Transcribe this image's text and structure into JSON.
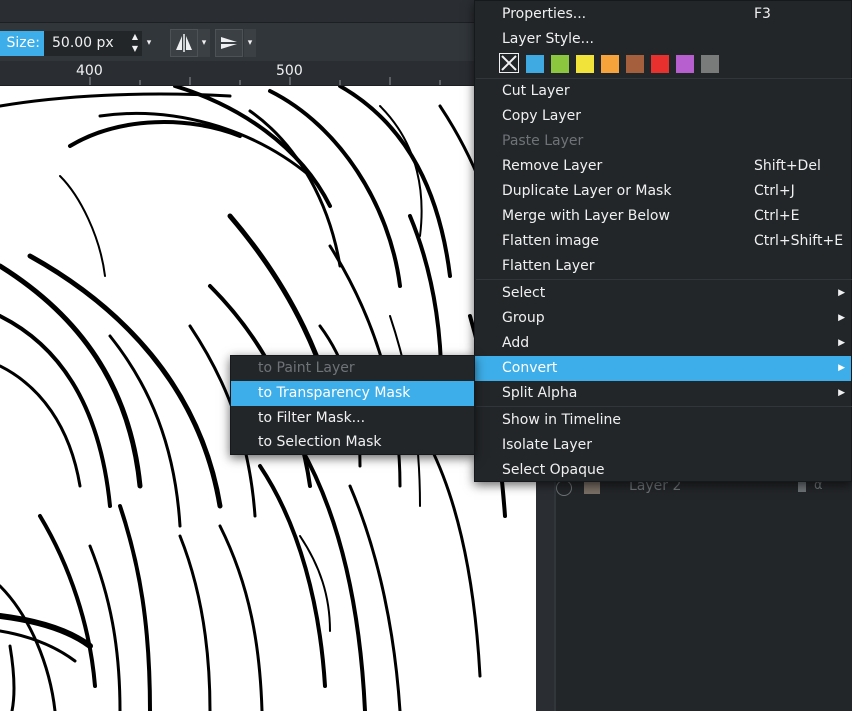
{
  "tool_options": {
    "size_label": "Size:",
    "size_value": "50.00 px",
    "spin_up": "▲",
    "spin_down": "▼",
    "dropdown_arrow": "▾",
    "icons": [
      "mirror-horizontal-icon",
      "mirror-vertical-icon"
    ]
  },
  "ruler": {
    "marks": [
      "400",
      "500"
    ]
  },
  "layers": {
    "row_label": "Layer 2"
  },
  "context_menu": {
    "properties": {
      "label": "Properties...",
      "shortcut": "F3"
    },
    "layer_style": {
      "label": "Layer Style..."
    },
    "color_labels": [
      "#3fa9e2",
      "#8cc63f",
      "#f2e33a",
      "#f5a33a",
      "#a65f3c",
      "#e8302f",
      "#b85fd0",
      "#797b7b"
    ],
    "cut_layer": {
      "label": "Cut Layer"
    },
    "copy_layer": {
      "label": "Copy Layer"
    },
    "paste_layer": {
      "label": "Paste Layer"
    },
    "remove_layer": {
      "label": "Remove Layer",
      "shortcut": "Shift+Del"
    },
    "duplicate_layer": {
      "label": "Duplicate Layer or Mask",
      "shortcut": "Ctrl+J"
    },
    "merge_down": {
      "label": "Merge with Layer Below",
      "shortcut": "Ctrl+E"
    },
    "flatten_image": {
      "label": "Flatten image",
      "shortcut": "Ctrl+Shift+E"
    },
    "flatten_layer": {
      "label": "Flatten Layer"
    },
    "select": {
      "label": "Select"
    },
    "group": {
      "label": "Group"
    },
    "add": {
      "label": "Add"
    },
    "convert": {
      "label": "Convert"
    },
    "split_alpha": {
      "label": "Split Alpha"
    },
    "show_timeline": {
      "label": "Show in Timeline"
    },
    "isolate_layer": {
      "label": "Isolate Layer"
    },
    "select_opaque": {
      "label": "Select Opaque"
    },
    "submenu_arrow": "▶"
  },
  "convert_submenu": {
    "items": [
      "to Paint Layer",
      "to Transparency Mask",
      "to Filter Mask...",
      "to Selection Mask"
    ]
  },
  "colors": {
    "accent": "#3daee9",
    "menu_bg": "#232629",
    "disabled": "#6e7377"
  }
}
